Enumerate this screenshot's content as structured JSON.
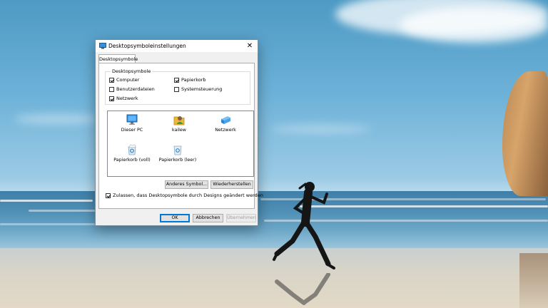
{
  "dialog": {
    "title": "Desktopsymboleinstellungen",
    "close_glyph": "✕",
    "tab_label": "Desktopsymbole",
    "group_label": "Desktopsymbole",
    "checkboxes": [
      {
        "label": "Computer",
        "checked": true
      },
      {
        "label": "Papierkorb",
        "checked": true
      },
      {
        "label": "Benutzerdateien",
        "checked": false
      },
      {
        "label": "Systemsteuerung",
        "checked": false
      },
      {
        "label": "Netzwerk",
        "checked": true
      }
    ],
    "icons": [
      {
        "label": "Dieser PC",
        "icon": "monitor-icon"
      },
      {
        "label": "kailew",
        "icon": "user-folder-icon"
      },
      {
        "label": "Netzwerk",
        "icon": "network-icon"
      },
      {
        "label": "Papierkorb (voll)",
        "icon": "recycle-bin-full-icon"
      },
      {
        "label": "Papierkorb (leer)",
        "icon": "recycle-bin-empty-icon"
      }
    ],
    "buttons": {
      "change_icon": "Anderes Symbol...",
      "restore": "Wiederherstellen",
      "ok": "OK",
      "cancel": "Abbrechen",
      "apply": "Übernehmen"
    },
    "allow_themes": {
      "label": "Zulassen, dass Desktopsymbole durch Designs geändert werden",
      "checked": true
    }
  },
  "colors": {
    "accent": "#0078d7",
    "selection_border": "#0078d7"
  }
}
